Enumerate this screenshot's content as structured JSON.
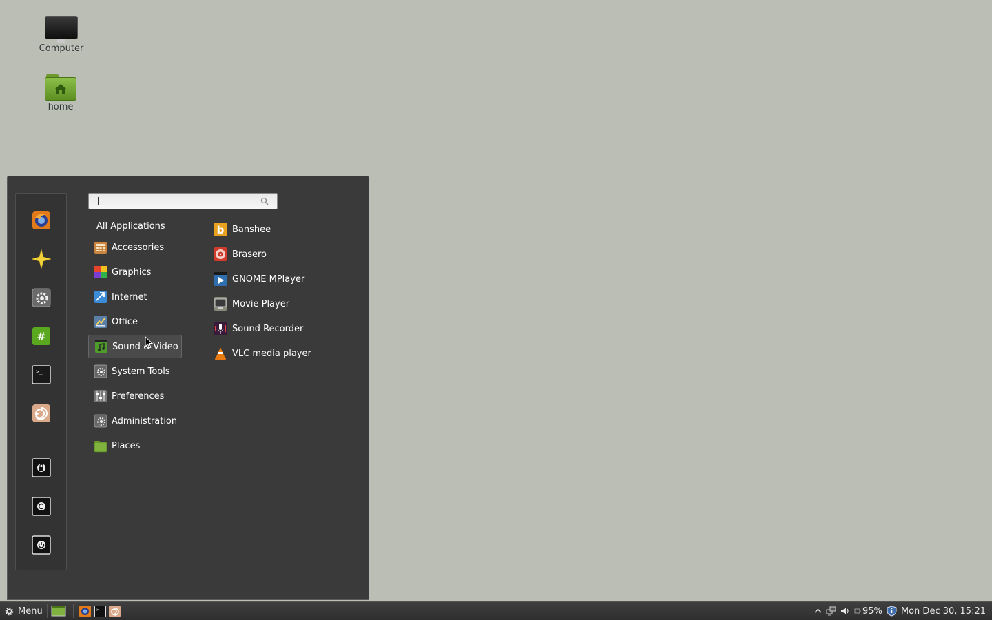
{
  "desktop": {
    "icons": [
      {
        "label": "Computer",
        "icon": "computer-icon"
      },
      {
        "label": "home",
        "icon": "home-folder-icon"
      }
    ]
  },
  "menu": {
    "favorites": [
      {
        "name": "firefox",
        "icon": "firefox-icon"
      },
      {
        "name": "software-manager",
        "icon": "star-icon"
      },
      {
        "name": "system-settings",
        "icon": "settings-icon"
      },
      {
        "name": "hexchat",
        "icon": "chat-icon"
      },
      {
        "name": "terminal",
        "icon": "terminal-icon"
      },
      {
        "name": "files",
        "icon": "shell-icon"
      }
    ],
    "session": [
      {
        "name": "lock-screen",
        "icon": "lock-icon"
      },
      {
        "name": "logout",
        "icon": "logout-icon"
      },
      {
        "name": "shutdown",
        "icon": "power-icon"
      }
    ],
    "search": {
      "value": "",
      "placeholder": ""
    },
    "all_applications": "All Applications",
    "categories": [
      {
        "label": "Accessories",
        "icon": "accessories-icon",
        "color": "#c9843e"
      },
      {
        "label": "Graphics",
        "icon": "graphics-icon",
        "color": "#d54a6e"
      },
      {
        "label": "Internet",
        "icon": "internet-icon",
        "color": "#3b8bd6"
      },
      {
        "label": "Office",
        "icon": "office-icon",
        "color": "#5a7fa8"
      },
      {
        "label": "Sound & Video",
        "icon": "sound-video-icon",
        "color": "#4e9a2a",
        "selected": true
      },
      {
        "label": "System Tools",
        "icon": "system-tools-icon",
        "color": "#666666"
      },
      {
        "label": "Preferences",
        "icon": "preferences-icon",
        "color": "#777777"
      },
      {
        "label": "Administration",
        "icon": "administration-icon",
        "color": "#666666"
      },
      {
        "label": "Places",
        "icon": "places-icon",
        "color": "#7fb23f"
      }
    ],
    "apps": [
      {
        "label": "Banshee",
        "icon": "banshee-icon",
        "color": "#e8a21f"
      },
      {
        "label": "Brasero",
        "icon": "brasero-icon",
        "color": "#d23b2b"
      },
      {
        "label": "GNOME MPlayer",
        "icon": "gnome-mplayer-icon",
        "color": "#2f6fb0"
      },
      {
        "label": "Movie Player",
        "icon": "movie-player-icon",
        "color": "#8a8a7a"
      },
      {
        "label": "Sound Recorder",
        "icon": "sound-recorder-icon",
        "color": "#6b2a6b"
      },
      {
        "label": "VLC media player",
        "icon": "vlc-icon",
        "color": "#e87a10"
      }
    ]
  },
  "taskbar": {
    "menu_label": "Menu",
    "battery": "95%",
    "clock": "Mon Dec 30, 15:21"
  }
}
